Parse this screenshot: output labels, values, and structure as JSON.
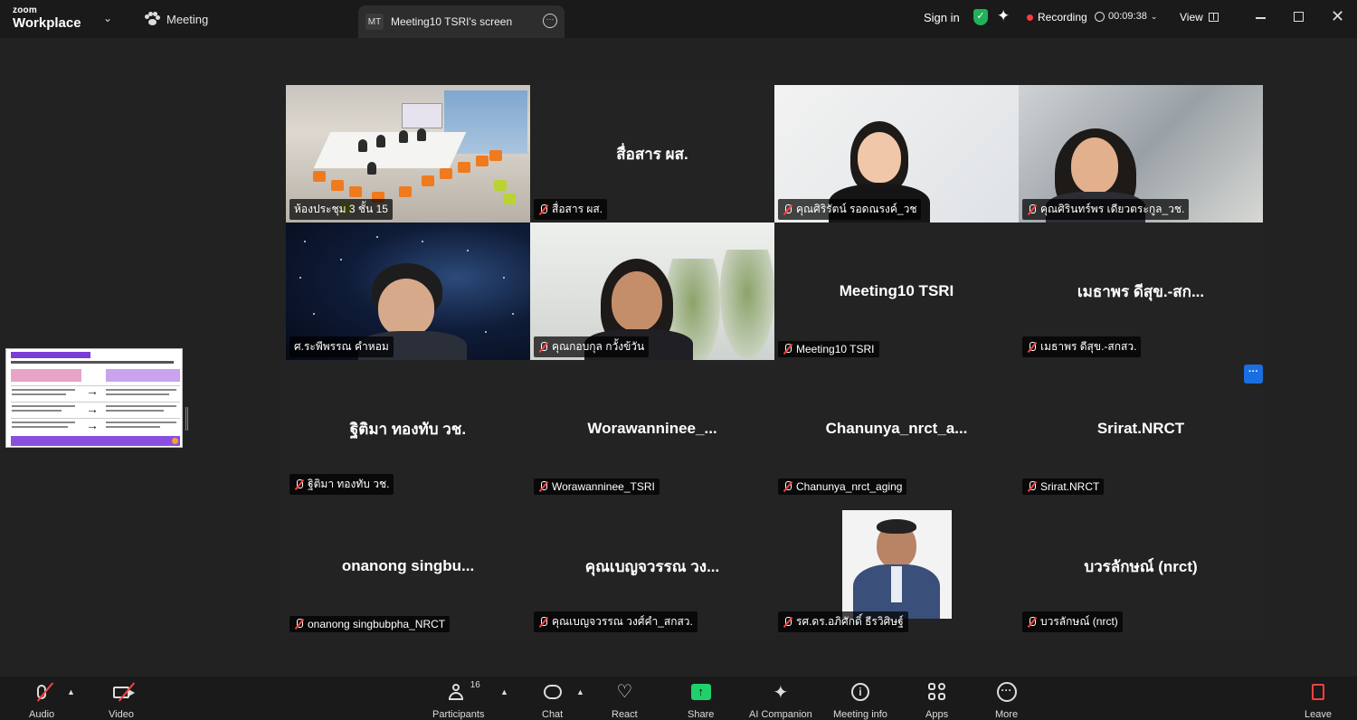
{
  "app": {
    "brand_line1": "zoom",
    "brand_line2": "Workplace",
    "meeting_tab": "Meeting",
    "screen_tab_badge": "MT",
    "screen_tab_title": "Meeting10 TSRI's screen",
    "sign_in": "Sign in",
    "recording_label": "Recording",
    "timer": "00:09:38",
    "view_label": "View",
    "accent_color": "#23d96b",
    "recording_color": "#ff3b3b"
  },
  "tiles": [
    {
      "label": "ห้องประชุม 3 ชั้น 15",
      "display_name": "",
      "muted": false,
      "video": "room",
      "active": true
    },
    {
      "label": "สื่อสาร ผส.",
      "display_name": "สื่อสาร ผส.",
      "muted": true,
      "video": "none",
      "active": false
    },
    {
      "label": "คุณศิริรัตน์ รอดณรงค์_วช",
      "display_name": "",
      "muted": true,
      "video": "woman1",
      "active": false
    },
    {
      "label": "คุณศิรินทร์พร เดียวตระกูล_วช.",
      "display_name": "",
      "muted": true,
      "video": "woman2",
      "active": false
    },
    {
      "label": "ศ.ระพีพรรณ คำหอม",
      "display_name": "",
      "muted": false,
      "video": "space",
      "active": false
    },
    {
      "label": "คุณกอบกุล กวั้งข้วัน",
      "display_name": "",
      "muted": true,
      "video": "office",
      "active": false
    },
    {
      "label": "Meeting10 TSRI",
      "display_name": "Meeting10 TSRI",
      "muted": true,
      "video": "none",
      "active": false
    },
    {
      "label": "เมธาพร ดีสุข.-สกสว.",
      "display_name": "เมธาพร ดีสุข.-สก...",
      "muted": true,
      "video": "none",
      "active": false
    },
    {
      "label": "ฐิติมา ทองทับ วช.",
      "display_name": "ฐิติมา ทองทับ วช.",
      "muted": true,
      "video": "none",
      "active": false
    },
    {
      "label": "Worawanninee_TSRI",
      "display_name": "Worawanninee_...",
      "muted": true,
      "video": "none",
      "active": false
    },
    {
      "label": "Chanunya_nrct_aging",
      "display_name": "Chanunya_nrct_a...",
      "muted": true,
      "video": "none",
      "active": false
    },
    {
      "label": "Srirat.NRCT",
      "display_name": "Srirat.NRCT",
      "muted": true,
      "video": "none",
      "active": false
    },
    {
      "label": "onanong singbubpha_NRCT",
      "display_name": "onanong  singbu...",
      "muted": true,
      "video": "none",
      "active": false
    },
    {
      "label": "คุณเบญจวรรณ วงศ์คำ_สกสว.",
      "display_name": "คุณเบญจวรรณ วง...",
      "muted": true,
      "video": "none",
      "active": false
    },
    {
      "label": "รศ.ดร.อภิศักดิ์ ธีรวิศิษฐ์",
      "display_name": "",
      "muted": true,
      "video": "photo",
      "active": false
    },
    {
      "label": "บวรลักษณ์ (nrct)",
      "display_name": "บวรลักษณ์ (nrct)",
      "muted": true,
      "video": "none",
      "active": false
    }
  ],
  "toolbar": {
    "audio": "Audio",
    "video": "Video",
    "participants": "Participants",
    "participants_count": "16",
    "chat": "Chat",
    "react": "React",
    "share": "Share",
    "ai_companion": "AI Companion",
    "meeting_info": "Meeting info",
    "apps": "Apps",
    "more": "More",
    "leave": "Leave"
  },
  "icons": [
    "chevron-down-icon",
    "paw-icon",
    "more-icon",
    "shield-icon",
    "sparkle-icon",
    "clock-icon",
    "view-icon",
    "minimize-icon",
    "maximize-icon",
    "close-icon",
    "mic-off-icon",
    "video-off-icon",
    "participants-icon",
    "chat-icon",
    "heart-icon",
    "share-icon",
    "ai-sparkle-icon",
    "info-icon",
    "apps-icon",
    "more-circle-icon",
    "leave-icon"
  ]
}
